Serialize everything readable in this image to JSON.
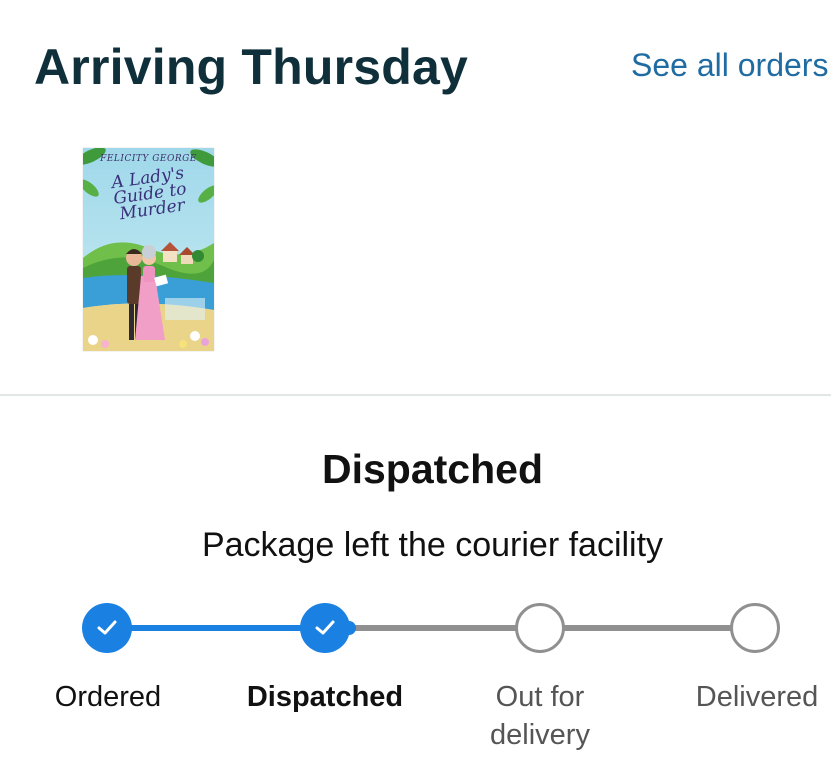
{
  "header": {
    "title": "Arriving Thursday",
    "see_all_label": "See all orders"
  },
  "item": {
    "cover_author": "FELICITY GEORGE",
    "cover_title": "A Lady's Guide to Murder"
  },
  "shipment": {
    "status": "Dispatched",
    "detail": "Package left the courier facility"
  },
  "progress": {
    "completed_steps": 2,
    "steps": [
      {
        "label": "Ordered",
        "state": "done"
      },
      {
        "label": "Dispatched",
        "state": "done"
      },
      {
        "label_line1": "Out for",
        "label_line2": "delivery",
        "state": "pending"
      },
      {
        "label": "Delivered",
        "state": "pending"
      }
    ]
  },
  "colors": {
    "title": "#0f2f3a",
    "link": "#1f6ca3",
    "accent": "#1a81e3",
    "pending_line": "#909090",
    "pending_label": "#555555"
  },
  "icons": {
    "done_step": "checkmark-icon",
    "pending_step": "empty-circle-icon"
  }
}
